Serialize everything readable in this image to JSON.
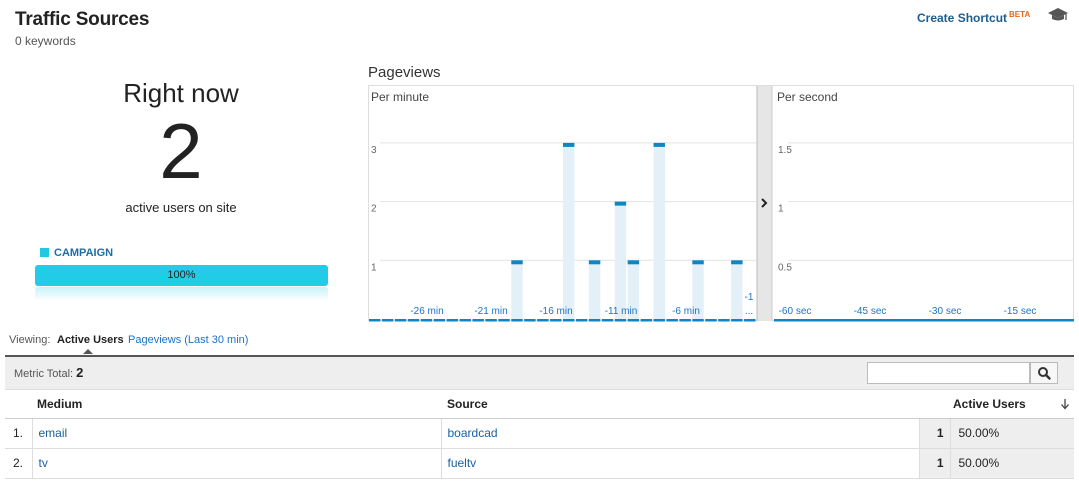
{
  "header": {
    "title": "Traffic Sources",
    "subtitle": "0 keywords",
    "shortcut_label": "Create Shortcut",
    "shortcut_badge": "BETA",
    "help_icon": "graduation-cap-icon"
  },
  "right_now": {
    "title": "Right now",
    "active_users": "2",
    "caption": "active users on site",
    "legend_label": "CAMPAIGN",
    "legend_color": "#22cce6",
    "bar_label": "100%",
    "bar_fraction": 1.0
  },
  "pageviews": {
    "title": "Pageviews"
  },
  "chart_data": [
    {
      "type": "bar",
      "title": "Per minute",
      "yticks": [
        "1",
        "2",
        "3"
      ],
      "ylim": [
        0,
        3.5
      ],
      "xtick_labels": [
        "-26 min",
        "-21 min",
        "-16 min",
        "-11 min",
        "-6 min",
        "-1 ..."
      ],
      "x": [
        -30,
        -29,
        -28,
        -27,
        -26,
        -25,
        -24,
        -23,
        -22,
        -21,
        -20,
        -19,
        -18,
        -17,
        -16,
        -15,
        -14,
        -13,
        -12,
        -11,
        -10,
        -9,
        -8,
        -7,
        -6,
        -5,
        -4,
        -3,
        -2,
        -1
      ],
      "values": [
        0,
        0,
        0,
        0,
        0,
        0,
        0,
        0,
        0,
        0,
        0,
        1,
        0,
        0,
        0,
        3,
        0,
        1,
        0,
        2,
        1,
        0,
        3,
        0,
        0,
        1,
        0,
        0,
        1,
        0
      ],
      "color": "#0f86c4",
      "bg_color": "#e3f0f8"
    },
    {
      "type": "bar",
      "title": "Per second",
      "yticks": [
        "0.5",
        "1",
        "1.5"
      ],
      "ylim": [
        0,
        1.75
      ],
      "xtick_labels": [
        "-60 sec",
        "-45 sec",
        "-30 sec",
        "-15 sec"
      ],
      "values": [],
      "color": "#0f86c4"
    }
  ],
  "view_toggle": {
    "label": "Viewing:",
    "active": "Active Users",
    "other": "Pageviews (Last 30 min)"
  },
  "metric": {
    "label": "Metric Total:",
    "value": "2",
    "search_placeholder": "",
    "search_icon": "magnifier-icon"
  },
  "table": {
    "columns": [
      "Medium",
      "Source",
      "Active Users"
    ],
    "sort_icon": "arrow-down-icon",
    "rows": [
      {
        "idx": "1.",
        "medium": "email",
        "source": "boardcad",
        "users": "1",
        "pct": "50.00%"
      },
      {
        "idx": "2.",
        "medium": "tv",
        "source": "fueltv",
        "users": "1",
        "pct": "50.00%"
      }
    ]
  }
}
